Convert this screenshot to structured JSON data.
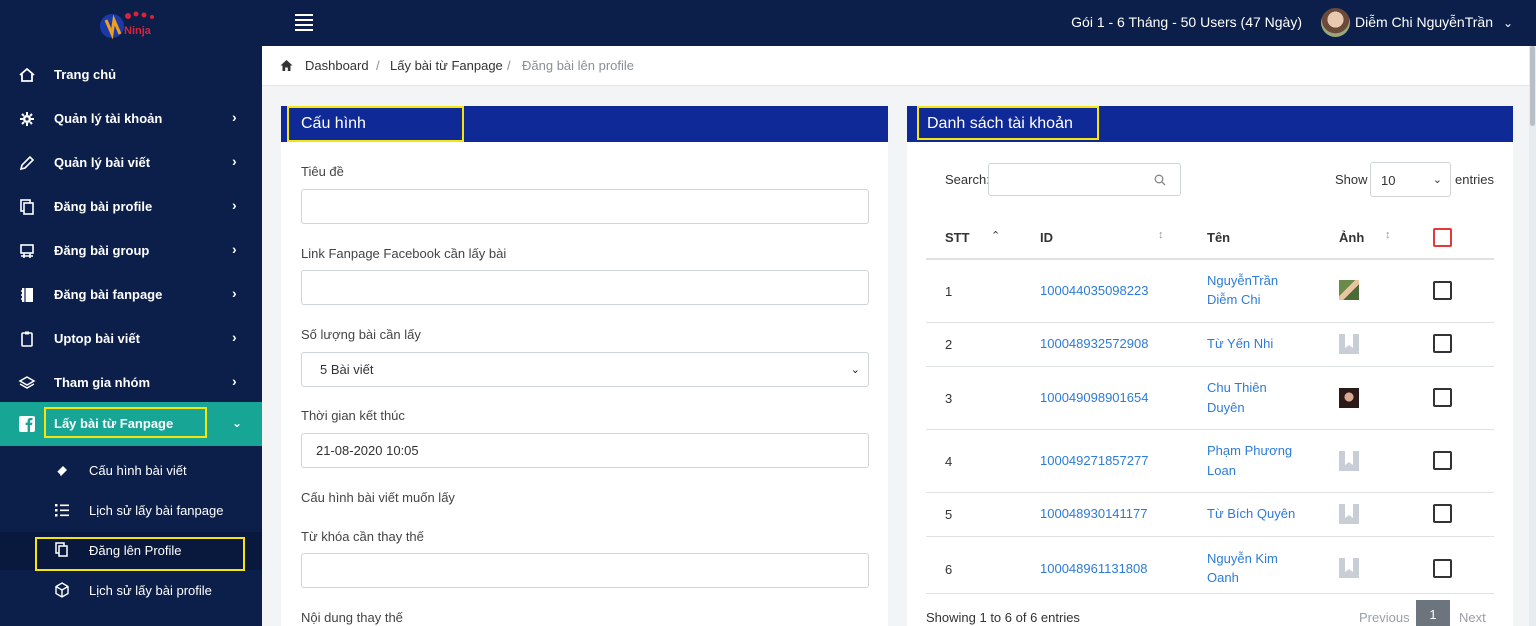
{
  "header": {
    "logo_text": "Ninja",
    "plan": "Gói 1 - 6 Tháng - 50 Users (47 Ngày)",
    "user_name": "Diễm Chi NguyễnTrần"
  },
  "sidebar": {
    "items": [
      {
        "label": "Trang chủ",
        "icon": "home-icon"
      },
      {
        "label": "Quản lý tài khoản",
        "icon": "gear-icon"
      },
      {
        "label": "Quản lý bài viết",
        "icon": "pencil-icon"
      },
      {
        "label": "Đăng bài profile",
        "icon": "copy-icon"
      },
      {
        "label": "Đăng bài group",
        "icon": "group-icon"
      },
      {
        "label": "Đăng bài fanpage",
        "icon": "notebook-icon"
      },
      {
        "label": "Uptop bài viết",
        "icon": "clipboard-icon"
      },
      {
        "label": "Tham gia nhóm",
        "icon": "layers-icon"
      },
      {
        "label": "Lấy bài từ Fanpage",
        "icon": "facebook-icon"
      }
    ],
    "sub_items": [
      {
        "label": "Cấu hình bài viết",
        "icon": "eraser-icon"
      },
      {
        "label": "Lịch sử lấy bài fanpage",
        "icon": "list-icon"
      },
      {
        "label": "Đăng lên Profile",
        "icon": "copy-icon"
      },
      {
        "label": "Lịch sử lấy bài profile",
        "icon": "cube-icon"
      }
    ]
  },
  "breadcrumb": {
    "home": "Dashboard",
    "parent": "Lấy bài từ Fanpage",
    "current": "Đăng bài lên profile"
  },
  "config": {
    "title": "Cấu hình",
    "fields": {
      "title_label": "Tiêu đề",
      "title_value": "",
      "link_label": "Link Fanpage Facebook cần lấy bài",
      "link_value": "",
      "count_label": "Số lượng bài cần lấy",
      "count_value": "5 Bài viết",
      "end_time_label": "Thời gian kết thúc",
      "end_time_value": "21-08-2020 10:05",
      "post_config_label": "Cấu hình bài viết muốn lấy",
      "replace_keyword_label": "Từ khóa cần thay thế",
      "replace_keyword_value": "",
      "replace_content_label": "Nội dung thay thế"
    }
  },
  "accounts": {
    "title": "Danh sách tài khoản",
    "search_label": "Search:",
    "search_value": "",
    "show_label": "Show",
    "page_length": "10",
    "entries_label": "entries",
    "columns": {
      "stt": "STT",
      "id": "ID",
      "name": "Tên",
      "avatar": "Ảnh"
    },
    "rows": [
      {
        "stt": "1",
        "id": "100044035098223",
        "name_l1": "NguyễnTrần",
        "name_l2": "Diễm Chi",
        "avatar": "photo"
      },
      {
        "stt": "2",
        "id": "100048932572908",
        "name_l1": "Từ Yến Nhi",
        "name_l2": "",
        "avatar": "placeholder"
      },
      {
        "stt": "3",
        "id": "100049098901654",
        "name_l1": "Chu Thiên",
        "name_l2": "Duyên",
        "avatar": "photo"
      },
      {
        "stt": "4",
        "id": "100049271857277",
        "name_l1": "Phạm Phương",
        "name_l2": "Loan",
        "avatar": "placeholder"
      },
      {
        "stt": "5",
        "id": "100048930141177",
        "name_l1": "Từ Bích Quyên",
        "name_l2": "",
        "avatar": "placeholder"
      },
      {
        "stt": "6",
        "id": "100048961131808",
        "name_l1": "Nguyễn Kim",
        "name_l2": "Oanh",
        "avatar": "placeholder"
      }
    ],
    "info": "Showing 1 to 6 of 6 entries",
    "pagination": {
      "previous": "Previous",
      "current": "1",
      "next": "Next"
    }
  },
  "colors": {
    "nav_bg": "#0c1f4a",
    "panel_header": "#0f2a96",
    "active_item": "#17a596",
    "highlight": "#f5e50c",
    "link": "#2d7bd8"
  }
}
